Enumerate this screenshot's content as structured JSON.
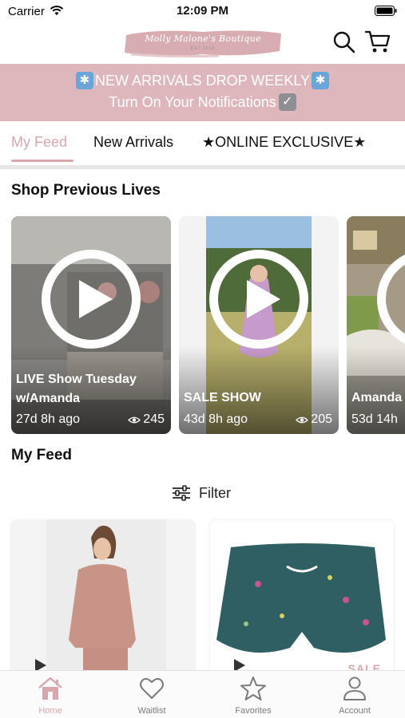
{
  "status_bar": {
    "carrier": "Carrier",
    "time": "12:09 PM"
  },
  "header": {
    "logo_text": "Molly Malone's Boutique",
    "logo_subtext": "EST 2016",
    "search_icon": "search-icon",
    "cart_icon": "cart-icon"
  },
  "banner": {
    "line1": "NEW ARRIVALS DROP WEEKLY",
    "line2": "Turn On Your Notifications",
    "line1_emoji": "✱",
    "line2_emoji": "✓",
    "background": "#ddb7bb"
  },
  "tabs": [
    {
      "label": "My Feed",
      "active": true
    },
    {
      "label": "New Arrivals",
      "active": false
    },
    {
      "label": "★ONLINE EXCLUSIVE★",
      "active": false
    }
  ],
  "lives_section": {
    "title": "Shop Previous Lives",
    "cards": [
      {
        "title": "LIVE Show Tuesday w/Amanda",
        "age": "27d 8h ago",
        "views": "245"
      },
      {
        "title": "SALE SHOW",
        "age": "43d 8h ago",
        "views": "205"
      },
      {
        "title": "Amanda",
        "age": "53d 14h",
        "views": ""
      }
    ]
  },
  "feed_section": {
    "title": "My Feed",
    "filter_label": "Filter",
    "products": [
      {
        "badge": ""
      },
      {
        "badge": "SALE"
      }
    ]
  },
  "tabbar": [
    {
      "label": "Home",
      "icon": "home-icon",
      "active": true
    },
    {
      "label": "Waitlist",
      "icon": "heart-icon",
      "active": false
    },
    {
      "label": "Favorites",
      "icon": "star-icon",
      "active": false
    },
    {
      "label": "Account",
      "icon": "person-icon",
      "active": false
    }
  ],
  "colors": {
    "accent": "#d7a7ad",
    "banner": "#ddb7bb"
  }
}
